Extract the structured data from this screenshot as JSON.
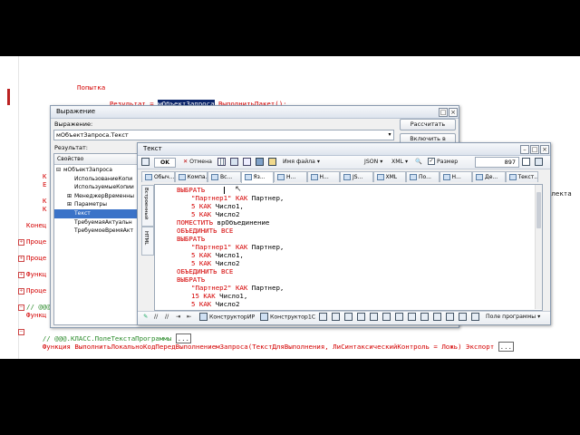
{
  "editor": {
    "line_try": "Попытка",
    "line_result_prefix": "Результат = ",
    "line_result_selected": "мОбъектЗапроса",
    "line_result_suffix": ".ВыполнитьПакет();",
    "left_fragments": [
      "К",
      "Е",
      "К",
      "К",
      "Конец"
    ],
    "right_fragment": "алекта",
    "proc_lines": [
      "Проце",
      "Проце",
      "Функц",
      "Проце"
    ],
    "comment_line": "// @@@.КЛАСС.ПолеТекстаПрограммы",
    "comment_func": "Функц",
    "bottom_comment": "// @@@.КЛАСС.ПолеТекстаПрограммы",
    "bottom_comment_box": "...",
    "bottom_function": "Функция ВыполнитьЛокальноКодПередВыполнениемЗапроса(ТекстДляВыполнения, ЛиСинтаксическийКонтроль = Ложь) Экспорт",
    "bottom_function_box": "..."
  },
  "expression_window": {
    "title": "Выражение",
    "expression_label": "Выражение:",
    "expression_value": "мОбъектЗапроса.Текст",
    "calc_button": "Рассчитать",
    "include_button": "Включить в табло",
    "result_label": "Результат:",
    "tree_header": "Свойство",
    "tree_items": [
      {
        "label": "мОбъектЗапроса",
        "expander": "⊟",
        "selected": false
      },
      {
        "label": "ИспользованиеКопи",
        "expander": "",
        "selected": false
      },
      {
        "label": "ИспользуемыеКопии",
        "expander": "",
        "selected": false
      },
      {
        "label": "МенеджерВременны",
        "expander": "⊞",
        "selected": false
      },
      {
        "label": "Параметры",
        "expander": "⊞",
        "selected": false
      },
      {
        "label": "Текст",
        "expander": "",
        "selected": true
      },
      {
        "label": "ТребуемаяАктуальн",
        "expander": "",
        "selected": false
      },
      {
        "label": "ТребуемоеВремяАкт",
        "expander": "",
        "selected": false
      }
    ]
  },
  "text_window": {
    "title": "Текст",
    "toolbar": {
      "ok": "OK",
      "cancel": "Отмена",
      "filename": "Имя файла",
      "json": "JSON",
      "xml": "XML",
      "size_label": "Размер",
      "size_value": "897"
    },
    "tabs": [
      "Обыч...",
      "Компа...",
      "Вс...",
      "Яз...",
      "Н...",
      "Н...",
      "JS...",
      "XML",
      "По...",
      "Н...",
      "Де...",
      "Текст..."
    ],
    "side_tabs": [
      "Встроенный",
      "HTML"
    ],
    "code_lines": [
      {
        "indent": 0,
        "parts": [
          {
            "t": "ВЫБРАТЬ",
            "kw": true
          }
        ]
      },
      {
        "indent": 1,
        "parts": [
          {
            "t": "\"Партнер1\"",
            "kw": true
          },
          {
            "t": " КАК ",
            "kw": true
          },
          {
            "t": "Партнер,",
            "kw": false
          }
        ]
      },
      {
        "indent": 1,
        "parts": [
          {
            "t": "5",
            "kw": true
          },
          {
            "t": " КАК ",
            "kw": true
          },
          {
            "t": "Число1,",
            "kw": false
          }
        ]
      },
      {
        "indent": 1,
        "parts": [
          {
            "t": "5",
            "kw": true
          },
          {
            "t": " КАК ",
            "kw": true
          },
          {
            "t": "Число2",
            "kw": false
          }
        ]
      },
      {
        "indent": 0,
        "parts": [
          {
            "t": "ПОМЕСТИТЬ",
            "kw": true
          },
          {
            "t": " врОбъединение",
            "kw": false
          }
        ]
      },
      {
        "indent": 0,
        "parts": [
          {
            "t": "ОБЪЕДИНИТЬ ВСЕ",
            "kw": true
          }
        ]
      },
      {
        "indent": 0,
        "parts": [
          {
            "t": "ВЫБРАТЬ",
            "kw": true
          }
        ]
      },
      {
        "indent": 1,
        "parts": [
          {
            "t": "\"Партнер1\"",
            "kw": true
          },
          {
            "t": " КАК ",
            "kw": true
          },
          {
            "t": "Партнер,",
            "kw": false
          }
        ]
      },
      {
        "indent": 1,
        "parts": [
          {
            "t": "5",
            "kw": true
          },
          {
            "t": " КАК ",
            "kw": true
          },
          {
            "t": "Число1,",
            "kw": false
          }
        ]
      },
      {
        "indent": 1,
        "parts": [
          {
            "t": "5",
            "kw": true
          },
          {
            "t": " КАК ",
            "kw": true
          },
          {
            "t": "Число2",
            "kw": false
          }
        ]
      },
      {
        "indent": 0,
        "parts": [
          {
            "t": "ОБЪЕДИНИТЬ ВСЕ",
            "kw": true
          }
        ]
      },
      {
        "indent": 0,
        "parts": [
          {
            "t": "ВЫБРАТЬ",
            "kw": true
          }
        ]
      },
      {
        "indent": 1,
        "parts": [
          {
            "t": "\"Партнер2\"",
            "kw": true
          },
          {
            "t": " КАК ",
            "kw": true
          },
          {
            "t": "Партнер,",
            "kw": false
          }
        ]
      },
      {
        "indent": 1,
        "parts": [
          {
            "t": "15",
            "kw": true
          },
          {
            "t": " КАК ",
            "kw": true
          },
          {
            "t": "Число1,",
            "kw": false
          }
        ]
      },
      {
        "indent": 1,
        "parts": [
          {
            "t": "5",
            "kw": true
          },
          {
            "t": " КАК ",
            "kw": true
          },
          {
            "t": "Число2",
            "kw": false
          }
        ]
      }
    ],
    "bottom_toolbar": {
      "constructor_ir": "КонструкторИР",
      "constructor_1c": "Конструктор1С",
      "program_field": "Поле программы"
    }
  },
  "colors": {
    "keyword": "#d40000",
    "selection": "#0a246a",
    "window_border": "#8a9bb0"
  }
}
